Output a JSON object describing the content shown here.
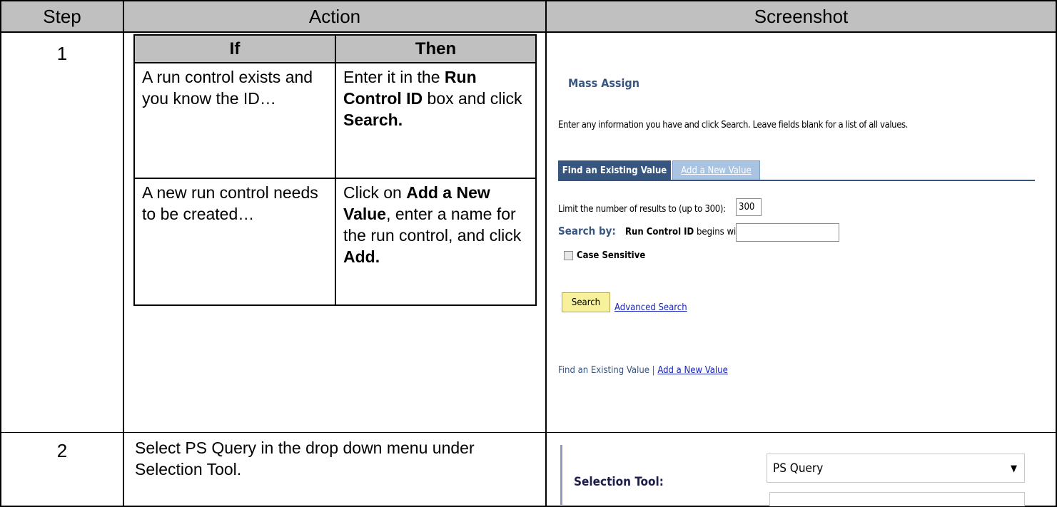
{
  "headers": {
    "step": "Step",
    "action": "Action",
    "screenshot": "Screenshot"
  },
  "rows": [
    {
      "step": "1",
      "inner_table": {
        "header_if": "If",
        "header_then": "Then",
        "row1": {
          "if": "A run control exists and you know the ID…",
          "then_pre": "Enter it in the ",
          "then_bold1": "Run Control ID",
          "then_mid": " box and click ",
          "then_bold2": "Search."
        },
        "row2": {
          "if": "A new run control needs to be created…",
          "then_pre": "Click on ",
          "then_bold1": "Add a New Value",
          "then_mid": ", enter a name for the run control, and click ",
          "then_bold2": "Add."
        }
      },
      "screenshot": {
        "title": "Mass Assign",
        "instructions": "Enter any information you have and click Search. Leave fields blank for a list of all values.",
        "tab_find": "Find an Existing Value",
        "tab_add": "Add a New Value",
        "limit_label": "Limit the number of results to (up to 300):",
        "limit_value": "300",
        "search_by_label": "Search by:",
        "search_field_label": "Run Control ID",
        "search_operator": "begins with",
        "search_value": "",
        "case_sensitive_label": "Case Sensitive",
        "search_button": "Search",
        "advanced_search_link": "Advanced Search",
        "footer_find": "Find an Existing Value",
        "footer_sep": "|",
        "footer_add": "Add a New Value"
      }
    },
    {
      "step": "2",
      "action": "Select PS Query in the drop down menu under Selection Tool.",
      "screenshot": {
        "selection_tool_label": "Selection Tool:",
        "selection_tool_value": "PS Query"
      }
    }
  ]
}
